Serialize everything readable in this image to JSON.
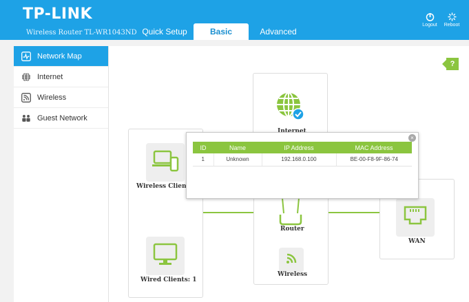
{
  "header": {
    "logo": "TP-LINK",
    "model": "Wireless Router TL-WR1043ND",
    "tabs": [
      {
        "label": "Quick Setup"
      },
      {
        "label": "Basic"
      },
      {
        "label": "Advanced"
      }
    ],
    "logout_label": "Logout",
    "reboot_label": "Reboot",
    "bg_color": "#1ea2e6"
  },
  "sidebar": {
    "items": [
      {
        "label": "Network Map",
        "icon": "network-map-icon",
        "active": true
      },
      {
        "label": "Internet",
        "icon": "globe-icon"
      },
      {
        "label": "Wireless",
        "icon": "wifi-icon"
      },
      {
        "label": "Guest Network",
        "icon": "guest-users-icon"
      }
    ]
  },
  "main": {
    "help_label": "?",
    "internet_label": "Internet",
    "wireless_clients_label": "Wireless Clients",
    "wired_clients_label": "Wired Clients: 1",
    "router_label": "Router",
    "wireless_label": "Wireless",
    "wan_label": "WAN",
    "accent_color": "#8bc53f"
  },
  "popup": {
    "close_label": "×",
    "headers": {
      "id": "ID",
      "name": "Name",
      "ip": "IP Address",
      "mac": "MAC Address"
    },
    "rows": [
      {
        "id": "1",
        "name": "Unknown",
        "ip": "192.168.0.100",
        "mac": "BE-00-F8-9F-86-74"
      }
    ]
  }
}
